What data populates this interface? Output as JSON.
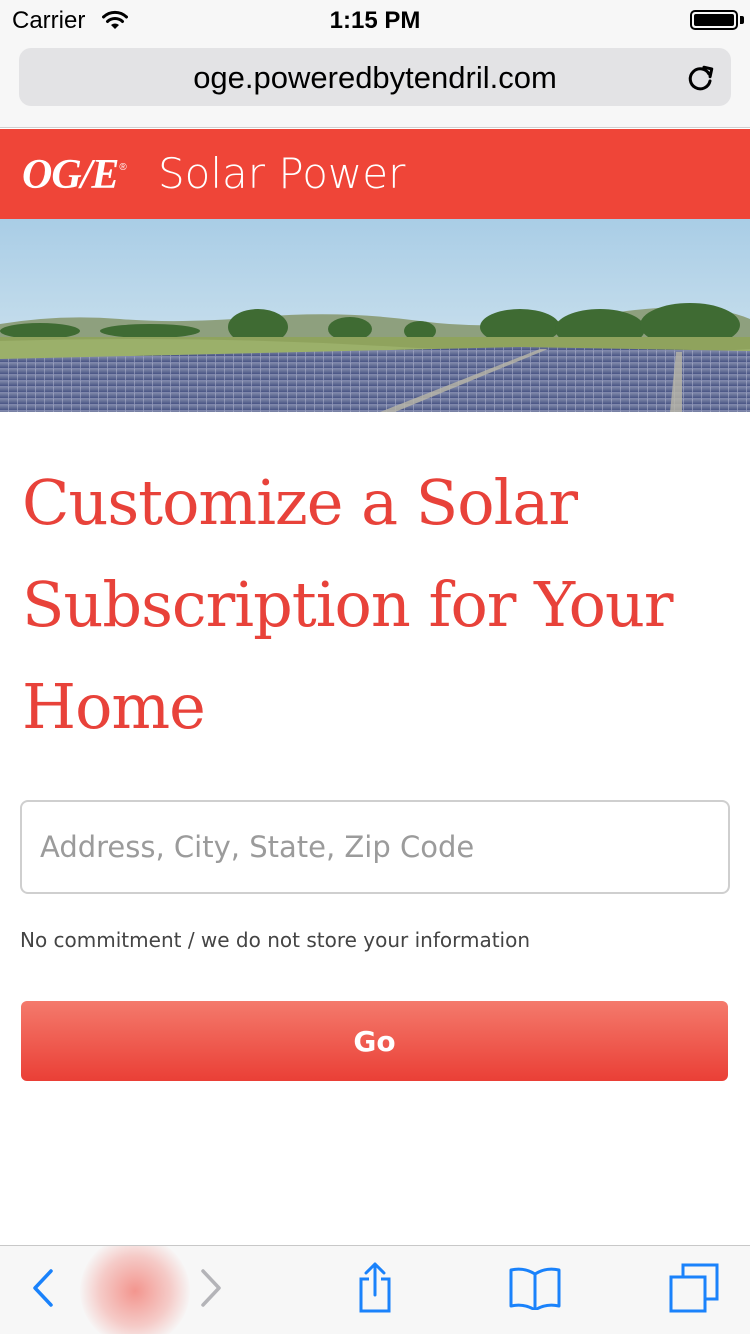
{
  "status_bar": {
    "carrier": "Carrier",
    "time": "1:15 PM"
  },
  "browser": {
    "url": "oge.poweredbytendril.com"
  },
  "header": {
    "logo": "OG/E",
    "title": "Solar Power",
    "brand_color": "#ef4538"
  },
  "main": {
    "headline": "Customize a Solar Subscription for Your Home",
    "address_placeholder": "Address, City, State, Zip Code",
    "disclaimer": "No commitment / we do not store your information",
    "go_label": "Go",
    "accent_color": "#e8423a"
  },
  "toolbar": {
    "icons": [
      "back-icon",
      "forward-icon",
      "share-icon",
      "bookmarks-icon",
      "tabs-icon"
    ]
  }
}
